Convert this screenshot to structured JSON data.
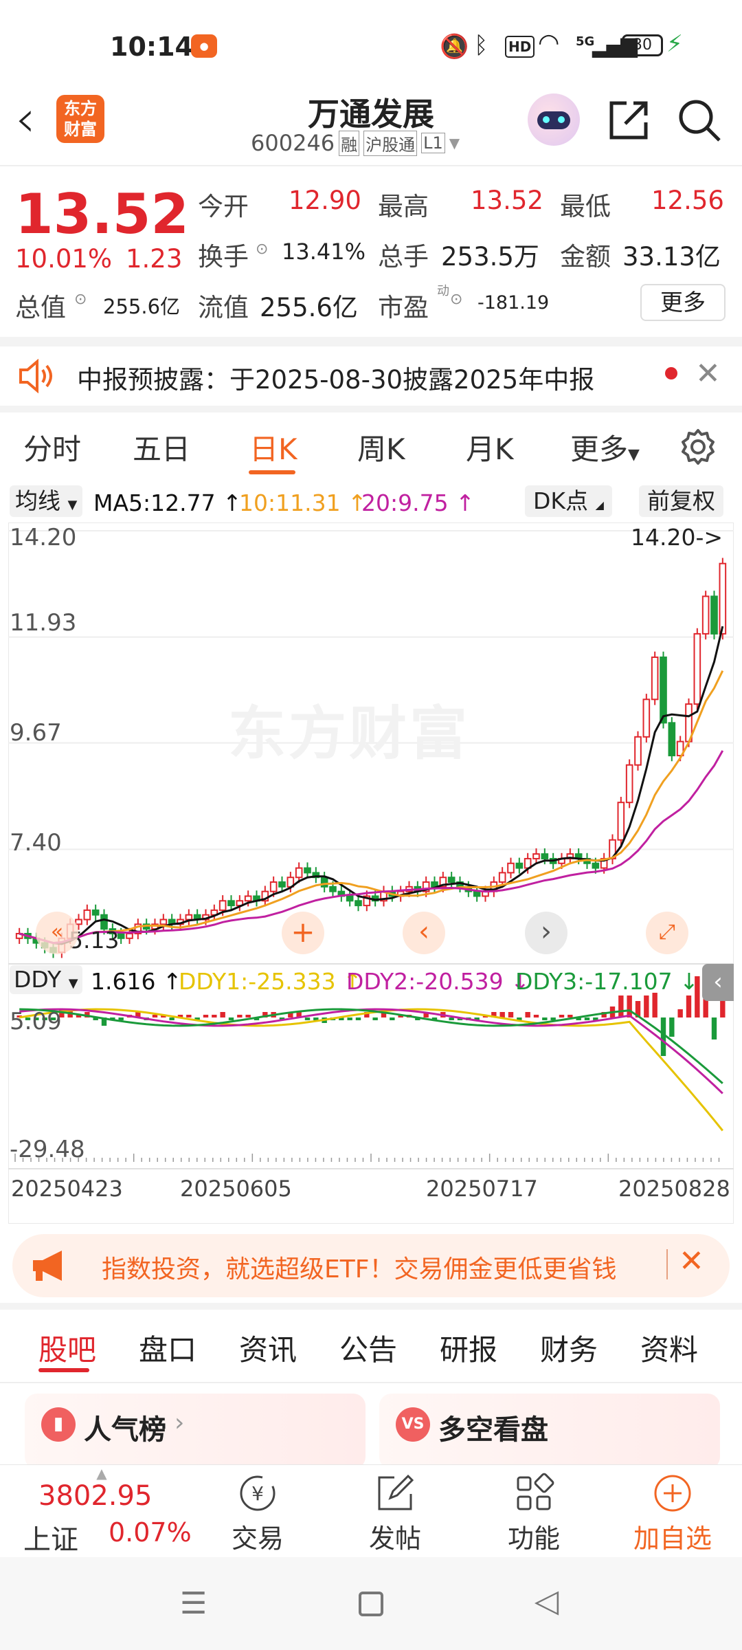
{
  "status": {
    "time": "10:14",
    "battery": "30",
    "network": "5G"
  },
  "nav": {
    "title": "万通发展",
    "code": "600246",
    "badges": [
      "融",
      "沪股通",
      "L1"
    ],
    "logo_line1": "东方",
    "logo_line2": "财富"
  },
  "quote": {
    "price": "13.52",
    "change_pct": "10.01%",
    "change": "1.23",
    "open_label": "今开",
    "open": "12.90",
    "high_label": "最高",
    "high": "13.52",
    "low_label": "最低",
    "low": "12.56",
    "turnover_label": "换手",
    "turnover": "13.41%",
    "volume_label": "总手",
    "volume": "253.5万",
    "amount_label": "金额",
    "amount": "33.13亿",
    "mcap_label": "总值",
    "mcap": "255.6亿",
    "float_label": "流值",
    "float": "255.6亿",
    "pe_label": "市盈",
    "pe_sup": "动",
    "pe": "-181.19",
    "more": "更多"
  },
  "notice": {
    "text": "中报预披露：于2025-08-30披露2025年中报"
  },
  "chart_tabs": [
    "分时",
    "五日",
    "日K",
    "周K",
    "月K",
    "更多"
  ],
  "ma_row": {
    "selector": "均线",
    "ma5": "MA5:12.77",
    "ma10": "10:11.31",
    "ma20": "20:9.75",
    "dk": "DK点",
    "adjust": "前复权"
  },
  "ind_row": {
    "selector": "DDY",
    "v": "1.616",
    "ddy1": "DDY1:-25.333",
    "ddy2": "DDY2:-20.539",
    "ddy3": "DDY3:-17.107"
  },
  "chart_data": {
    "type": "candlestick",
    "y_ticks": [
      "14.20",
      "11.93",
      "9.67",
      "7.40"
    ],
    "ylim": [
      5.13,
      14.2
    ],
    "max_label": "14.20->",
    "min_label": "5.13",
    "watermark": "东方财富",
    "x_ticks": [
      "20250423",
      "20250605",
      "20250717",
      "20250828"
    ],
    "indicator_ticks": [
      "5.09",
      "-29.48"
    ],
    "closes": [
      5.6,
      5.5,
      5.4,
      5.3,
      5.2,
      5.5,
      5.8,
      5.9,
      6.1,
      6.0,
      5.7,
      5.6,
      5.5,
      5.6,
      5.8,
      5.7,
      5.8,
      5.9,
      5.8,
      5.9,
      6.0,
      5.9,
      6.0,
      6.1,
      6.3,
      6.2,
      6.3,
      6.4,
      6.3,
      6.5,
      6.7,
      6.6,
      6.8,
      7.0,
      6.9,
      6.8,
      6.6,
      6.5,
      6.4,
      6.3,
      6.2,
      6.4,
      6.3,
      6.5,
      6.4,
      6.5,
      6.6,
      6.5,
      6.7,
      6.6,
      6.8,
      6.7,
      6.6,
      6.5,
      6.4,
      6.5,
      6.7,
      6.9,
      7.1,
      7.0,
      7.2,
      7.3,
      7.2,
      7.1,
      7.2,
      7.3,
      7.2,
      7.1,
      7.0,
      7.2,
      7.6,
      8.4,
      9.2,
      9.8,
      10.6,
      11.5,
      10.1,
      9.4,
      9.7,
      10.5,
      12.0,
      12.8,
      12.0,
      13.5
    ]
  },
  "promo": {
    "text": "指数投资，就选超级ETF！交易佣金更低更省钱"
  },
  "lower_tabs": [
    "股吧",
    "盘口",
    "资讯",
    "公告",
    "研报",
    "财务",
    "资料"
  ],
  "cards": [
    {
      "label": "人气榜",
      "icon": "chart-bar-icon"
    },
    {
      "label": "多空看盘",
      "icon": "vs-icon"
    }
  ],
  "bottom": {
    "index_value": "3802.95",
    "index_name": "上证",
    "index_change": "0.07%",
    "items": [
      "交易",
      "发帖",
      "功能",
      "加自选"
    ]
  },
  "colors": {
    "up": "#e0262d",
    "down": "#1a9a3a",
    "ma5": "#111111",
    "ma10": "#f0a020",
    "ma20": "#c020a0",
    "accent": "#f26522"
  }
}
